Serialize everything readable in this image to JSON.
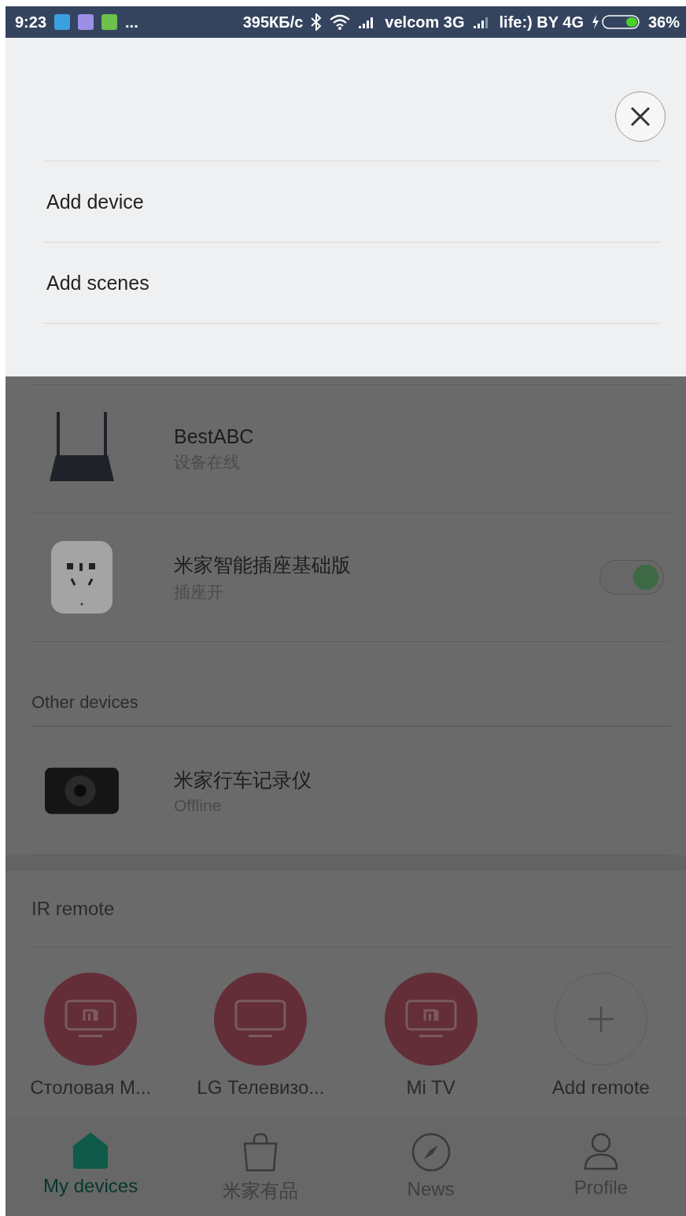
{
  "status_bar": {
    "time": "9:23",
    "more": "...",
    "speed": "395КБ/с",
    "carrier_1": "velcom 3G",
    "carrier_2": "life:) BY 4G",
    "battery": "36%"
  },
  "menu": {
    "items": [
      "Add device",
      "Add scenes"
    ]
  },
  "device_groups": [
    {
      "devices": [
        {
          "name": "BestABC",
          "status": "设备在线",
          "kind": "router"
        },
        {
          "name": "米家智能插座基础版",
          "status": "插座开",
          "kind": "plug",
          "on": true
        }
      ]
    },
    {
      "title": "Other devices",
      "devices": [
        {
          "name": "米家行车记录仪",
          "status": "Offline",
          "kind": "dashcam"
        }
      ]
    }
  ],
  "ir_remote": {
    "title": "IR remote",
    "remotes": [
      {
        "label": "Столовая M...",
        "kind": "mi_tv"
      },
      {
        "label": "LG Телевизо...",
        "kind": "tv"
      },
      {
        "label": "Mi TV",
        "kind": "mi_tv"
      },
      {
        "label": "Add remote",
        "kind": "add"
      }
    ]
  },
  "tabs": [
    {
      "label": "My devices",
      "kind": "home",
      "selected": true
    },
    {
      "label": "米家有品",
      "kind": "bag",
      "selected": false
    },
    {
      "label": "News",
      "kind": "compass",
      "selected": false
    },
    {
      "label": "Profile",
      "kind": "person",
      "selected": false
    }
  ]
}
